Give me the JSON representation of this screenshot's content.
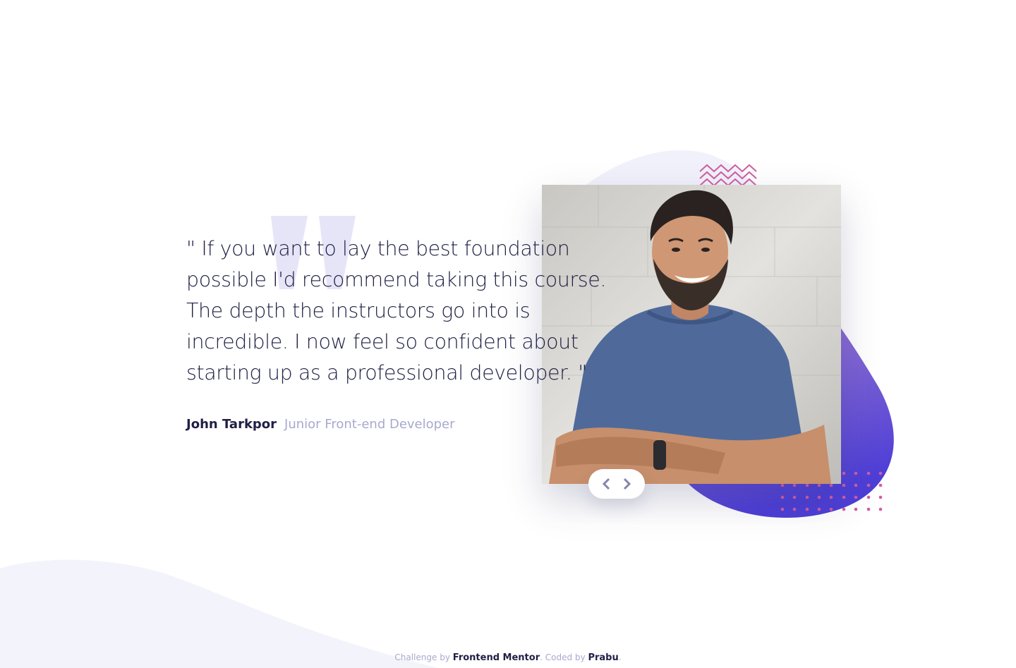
{
  "testimonial": {
    "quote": "\" If you want to lay the best foundation possible I'd recommend taking this course. The depth the instructors go into is incredible. I now feel so confident about starting up as a professional developer. \"",
    "author_name": "John Tarkpor",
    "author_role": "Junior Front-end Developer"
  },
  "photo": {
    "alt": "John Tarkpor"
  },
  "navigation": {
    "prev_icon": "chevron-left-icon",
    "next_icon": "chevron-right-icon"
  },
  "footer": {
    "challenge_prefix": "Challenge by",
    "challenge_link": "Frontend Mentor",
    "coded_prefix": ". Coded by",
    "coded_link": "Prabu",
    "suffix": "."
  },
  "colors": {
    "dark_navy": "#202046",
    "grayish_blue": "#a9a8cf",
    "quote_mark": "#e6e5f8",
    "pattern_pink": "#d05ea1",
    "blob_gradient_top": "#8c69ce",
    "blob_gradient_bottom": "#4d3ed6",
    "bg_curve": "#f3f3fb"
  }
}
